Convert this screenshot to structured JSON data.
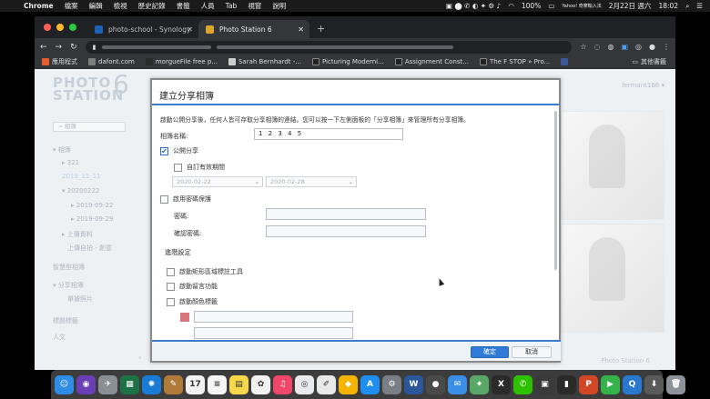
{
  "menubar": {
    "app": "Chrome",
    "items": [
      "檔案",
      "編輯",
      "檢視",
      "歷史記錄",
      "書籤",
      "人員",
      "Tab",
      "視窗",
      "說明"
    ],
    "battery": "100%",
    "yahoo": "Yahoo! 奇摩輸入法",
    "date": "2月22日 週六",
    "time": "18:02"
  },
  "browser": {
    "tabs": [
      {
        "title": "photo-school - Synology DiskS",
        "active": false,
        "favicon_color": "#1c62b6"
      },
      {
        "title": "Photo Station 6",
        "active": true,
        "favicon_color": "#d9a52a"
      }
    ],
    "new_tab": "+",
    "bookmarks": [
      {
        "label": "應用程式",
        "color": "#e65c2e"
      },
      {
        "label": "dafont.com",
        "color": "#7d7d7d"
      },
      {
        "label": "morgueFile free p...",
        "color": "#2a2a2a"
      },
      {
        "label": "Sarah Bernhardt -...",
        "color": "#cfcfcf"
      },
      {
        "label": "Picturing Moderni...",
        "color": "#222"
      },
      {
        "label": "Assignment Const...",
        "color": "#222"
      },
      {
        "label": "The F STOP » Pro...",
        "color": "#222"
      },
      {
        "label": "",
        "color": "#3b5998"
      }
    ],
    "other_bookmarks": "其他書籤"
  },
  "sidebar": {
    "logo_line1": "PHOTO",
    "logo_line2": "STATION",
    "logo_number": "6",
    "search_placeholder": "相簿",
    "items": [
      {
        "label": "▾ 相簿",
        "indent": 0,
        "selected": false
      },
      {
        "label": "▸ 321",
        "indent": 1,
        "selected": false
      },
      {
        "label": "2019_11_11",
        "indent": 1,
        "selected": true
      },
      {
        "label": "▾ 20200222",
        "indent": 1,
        "selected": false
      },
      {
        "label": "▸ 2019-09-22",
        "indent": 2,
        "selected": false
      },
      {
        "label": "▸ 2019-09-29",
        "indent": 2,
        "selected": false
      },
      {
        "label": "▸ 上傳資料",
        "indent": 1,
        "selected": false
      },
      {
        "label": "上傳自拍 - 創意",
        "indent": 2,
        "selected": false
      },
      {
        "label": "智慧型相簿",
        "indent": 0,
        "selected": false
      },
      {
        "label": "▾ 分享相簿",
        "indent": 0,
        "selected": false
      },
      {
        "label": "單據照片",
        "indent": 1,
        "selected": false
      },
      {
        "label": "標題標籤",
        "indent": 0,
        "selected": false
      },
      {
        "label": "人文",
        "indent": 0,
        "selected": false
      }
    ],
    "user": "fermant168 ▾",
    "footer_brand": "Photo Station 6"
  },
  "dialog": {
    "title": "建立分享相簿",
    "description": "啟動公開分享後，任何人皆可存取分享相簿的連結。您可以按一下左側面板的「分享相簿」來管理所有分享相簿。",
    "album_name_label": "相簿名稱:",
    "album_name_value": "1 2 3 4 5",
    "public_share_label": "公開分享",
    "public_share_checked": true,
    "custom_validity_label": "自訂有效期間",
    "custom_validity_checked": false,
    "date_from": "2020-02-22",
    "date_to": "2020-02-28",
    "password_protect_label": "啟用密碼保護",
    "password_protect_checked": false,
    "password_label": "密碼:",
    "confirm_password_label": "確認密碼:",
    "advanced_label": "進階設定",
    "region_label_tool": "啟動矩形區域標註工具",
    "comments_label": "啟動留言功能",
    "color_label_label": "啟動顏色標籤",
    "swatch_color": "#d9747a",
    "ok_label": "確定",
    "cancel_label": "取消"
  },
  "dock": {
    "apps": [
      {
        "name": "finder-icon",
        "color": "#2e8de6",
        "glyph": "☺"
      },
      {
        "name": "siri-icon",
        "color": "#6a3fb5",
        "glyph": "◉"
      },
      {
        "name": "launchpad-icon",
        "color": "#8a8f96",
        "glyph": "✈"
      },
      {
        "name": "excel-icon",
        "color": "#1e7145",
        "glyph": "▦"
      },
      {
        "name": "safari-icon",
        "color": "#1a7bd6",
        "glyph": "✺"
      },
      {
        "name": "notes-icon",
        "color": "#b07a38",
        "glyph": "✎"
      },
      {
        "name": "calendar-icon",
        "color": "#f2f2f2",
        "glyph": "17"
      },
      {
        "name": "reminders-icon",
        "color": "#f5f5f5",
        "glyph": "≡"
      },
      {
        "name": "stickies-icon",
        "color": "#f6d84a",
        "glyph": "▤"
      },
      {
        "name": "photos-icon",
        "color": "#f2f2f2",
        "glyph": "✿"
      },
      {
        "name": "music-icon",
        "color": "#f0466a",
        "glyph": "♫"
      },
      {
        "name": "chrome-icon",
        "color": "#e8eaed",
        "glyph": "◎"
      },
      {
        "name": "textedit-icon",
        "color": "#e9e9e9",
        "glyph": "✐"
      },
      {
        "name": "sketch-icon",
        "color": "#f5b400",
        "glyph": "◆"
      },
      {
        "name": "appstore-icon",
        "color": "#1e8ef0",
        "glyph": "A"
      },
      {
        "name": "system-preferences-icon",
        "color": "#7a7f86",
        "glyph": "⚙"
      },
      {
        "name": "word-icon",
        "color": "#2b579a",
        "glyph": "W"
      },
      {
        "name": "camera-icon",
        "color": "#4a4a4a",
        "glyph": "●"
      },
      {
        "name": "mail-icon",
        "color": "#3b8ee6",
        "glyph": "✉"
      },
      {
        "name": "maps-icon",
        "color": "#5aa868",
        "glyph": "⌖"
      },
      {
        "name": "xcode-icon",
        "color": "#2a2a2a",
        "glyph": "X"
      },
      {
        "name": "wechat-icon",
        "color": "#2dc100",
        "glyph": "✆"
      },
      {
        "name": "screenshot-icon",
        "color": "#3a3a3a",
        "glyph": "▣"
      },
      {
        "name": "terminal-icon",
        "color": "#2a2a2a",
        "glyph": "▮"
      },
      {
        "name": "powerpoint-icon",
        "color": "#d24726",
        "glyph": "P"
      },
      {
        "name": "facetime-icon",
        "color": "#35b34a",
        "glyph": "▶"
      },
      {
        "name": "quicktime-icon",
        "color": "#2878d0",
        "glyph": "Q"
      },
      {
        "name": "downloads-icon",
        "color": "#5a5a5a",
        "glyph": "⬇"
      },
      {
        "name": "trash-icon",
        "color": "#8d9199",
        "glyph": "🗑"
      }
    ]
  }
}
